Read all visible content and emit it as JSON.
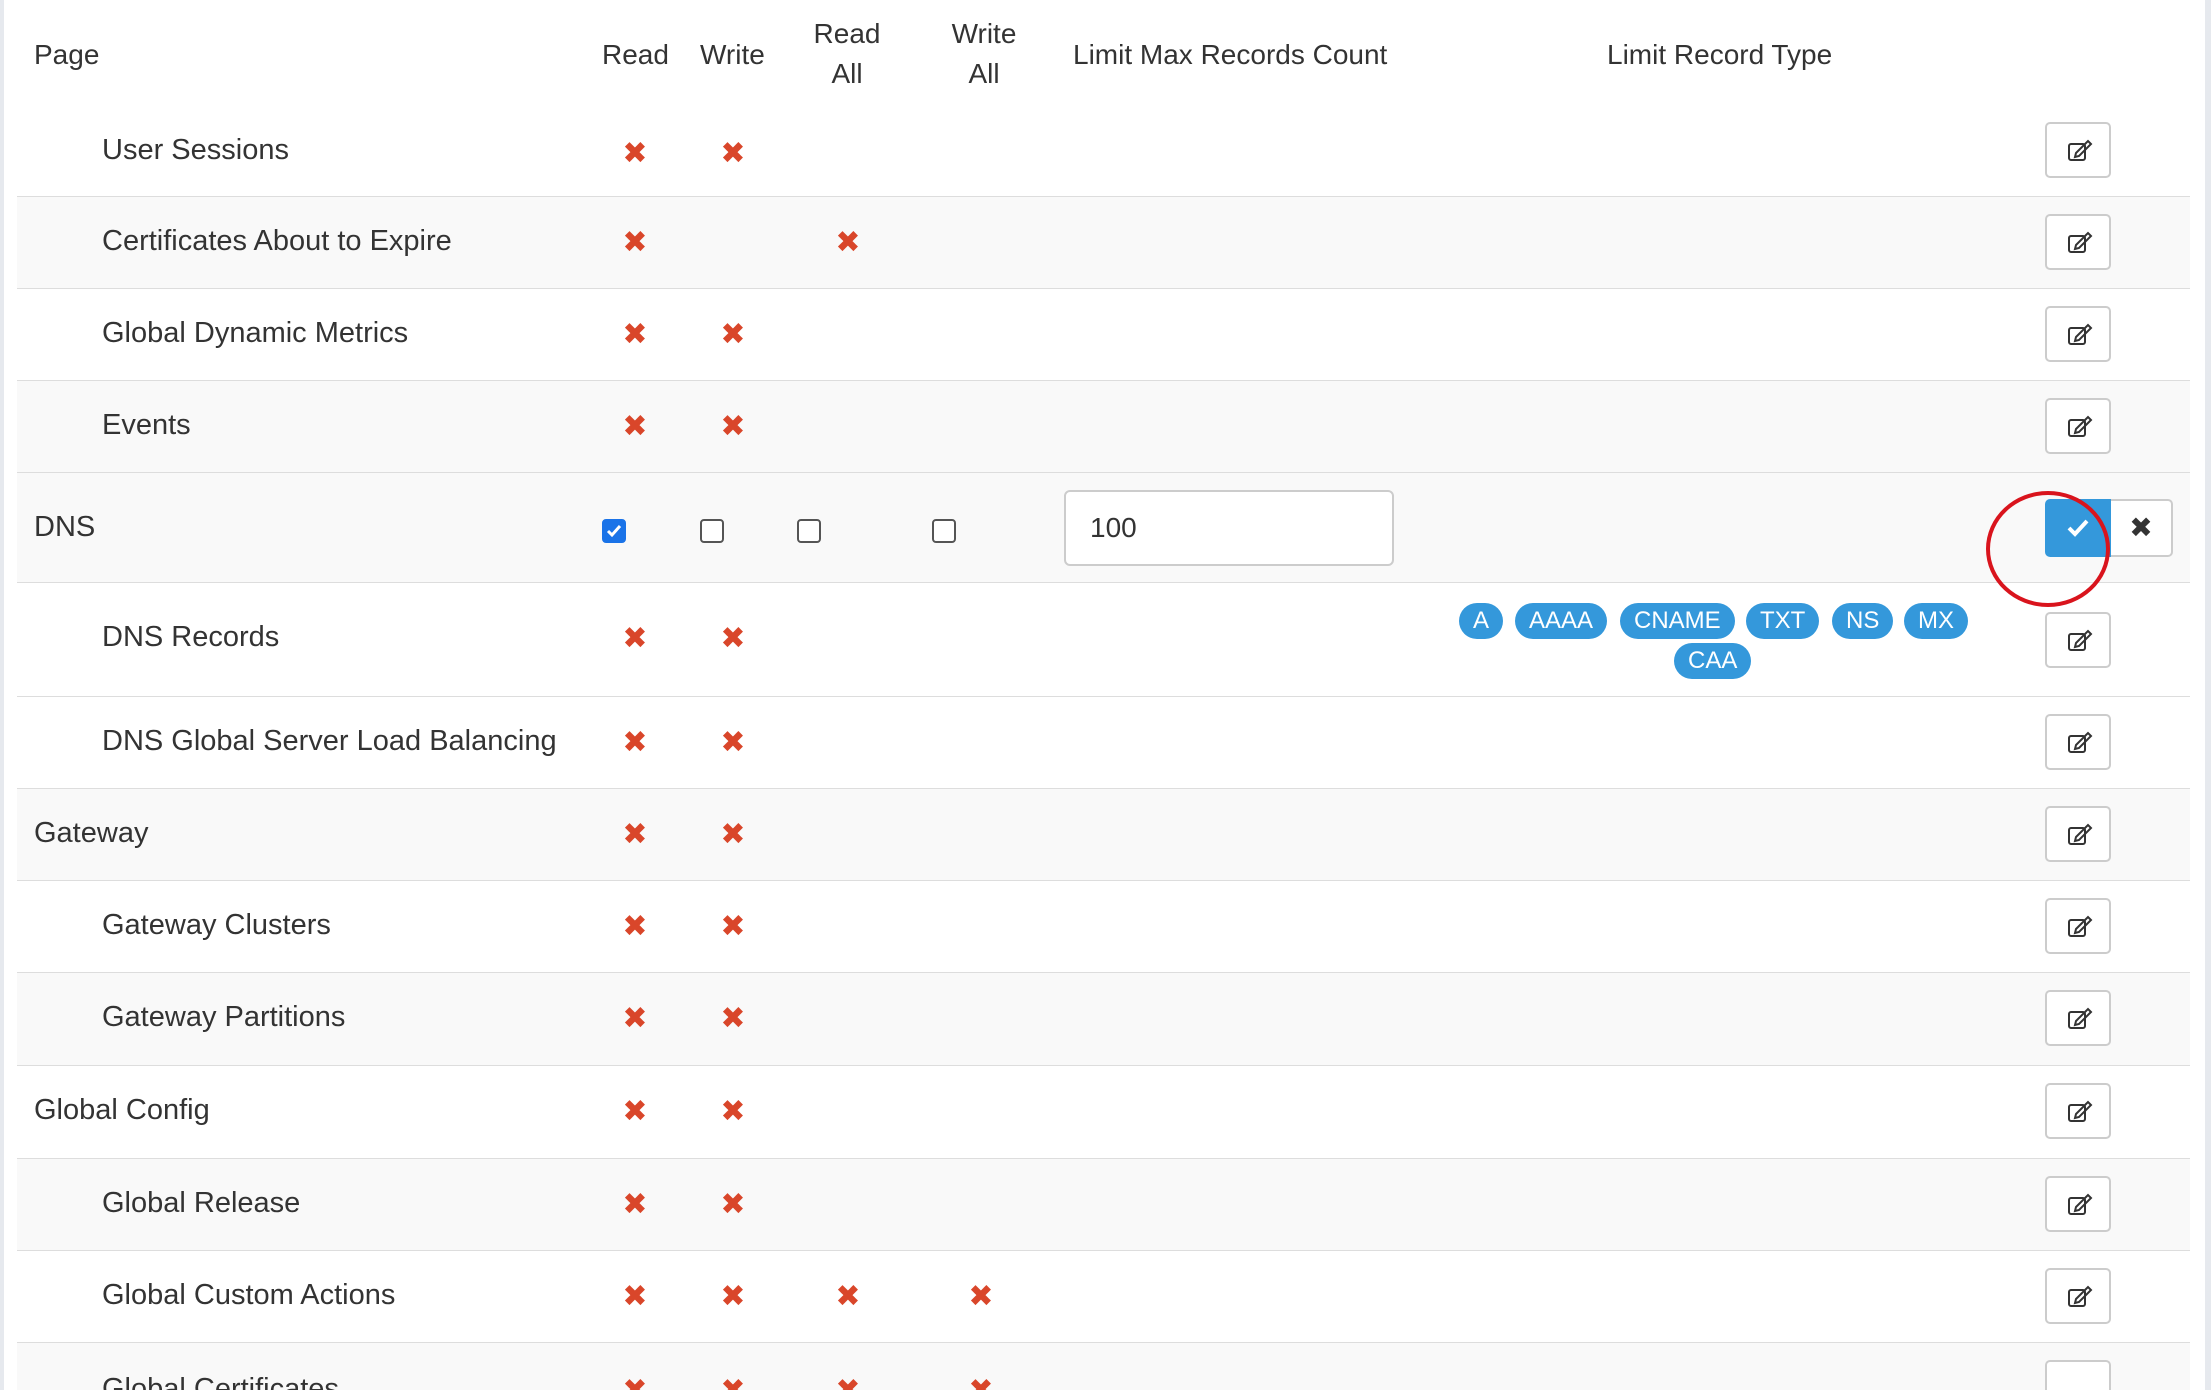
{
  "header": {
    "page": "Page",
    "read": "Read",
    "write": "Write",
    "read_all_1": "Read",
    "read_all_2": "All",
    "write_all_1": "Write",
    "write_all_2": "All",
    "limit_max": "Limit Max Records Count",
    "limit_type": "Limit Record Type"
  },
  "rows": {
    "user_sessions": "User Sessions",
    "certs_expire": "Certificates About to Expire",
    "global_dynamic_metrics": "Global Dynamic Metrics",
    "events": "Events",
    "dns": "DNS",
    "dns_records": "DNS Records",
    "dns_gslb": "DNS Global Server Load Balancing",
    "gateway": "Gateway",
    "gateway_clusters": "Gateway Clusters",
    "gateway_partitions": "Gateway Partitions",
    "global_config": "Global Config",
    "global_release": "Global Release",
    "global_custom_actions": "Global Custom Actions",
    "global_certificates": "Global Certificates"
  },
  "dns_edit": {
    "read_checked": true,
    "write_checked": false,
    "read_all_checked": false,
    "write_all_checked": false,
    "max_records": "100"
  },
  "record_types": [
    "A",
    "AAAA",
    "CNAME",
    "TXT",
    "NS",
    "MX",
    "CAA"
  ],
  "icons": {
    "denied": "x-mark-icon",
    "edit": "edit-icon",
    "confirm": "check-icon",
    "cancel": "close-icon"
  },
  "colors": {
    "denied": "#d9462a",
    "accent": "#3498db",
    "annotation": "#d9141d"
  },
  "cancel_glyph": "✖"
}
